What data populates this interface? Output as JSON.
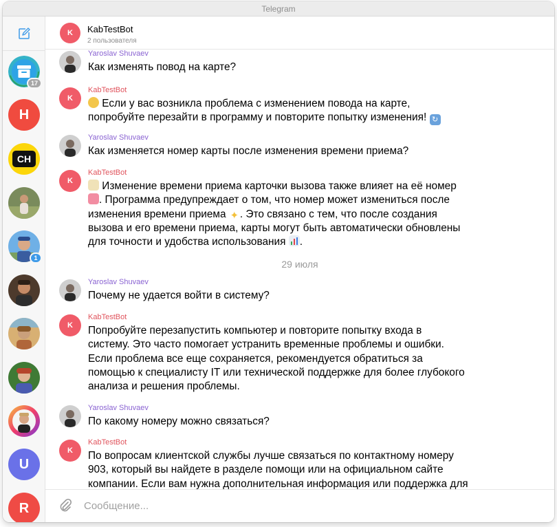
{
  "window": {
    "title": "Telegram"
  },
  "colors": {
    "bot_avatar": "#f05b68",
    "bot_name": "#e0535c",
    "user_name": "#8a63d2",
    "accent": "#3d9ae8"
  },
  "icons": {
    "compose": "compose-icon",
    "attach": "paperclip-icon"
  },
  "sidebar": {
    "chats": [
      {
        "type": "archive",
        "badge": "17"
      },
      {
        "type": "letter",
        "letter": "H",
        "color": "#f04b3f"
      },
      {
        "type": "logo",
        "letter": "CH"
      },
      {
        "type": "photo"
      },
      {
        "type": "photo",
        "badge": "1"
      },
      {
        "type": "photo"
      },
      {
        "type": "photo"
      },
      {
        "type": "photo"
      },
      {
        "type": "photo"
      },
      {
        "type": "letter",
        "letter": "U",
        "color": "#6a71e8"
      },
      {
        "type": "letter",
        "letter": "R",
        "color": "#ef4b45"
      }
    ]
  },
  "chat": {
    "title": "KabTestBot",
    "subtitle": "2 пользователя",
    "avatar_letter": "K"
  },
  "messages": [
    {
      "sender": "Yaroslav Shuvaev",
      "role": "user",
      "lines": [
        "Как изменять повод на карте?"
      ]
    },
    {
      "sender": "KabTestBot",
      "role": "bot",
      "lines": [
        "Если у вас возникла проблема с изменением повода на карте,",
        "попробуйте перезайти в программу и повторите попытку изменения!"
      ]
    },
    {
      "sender": "Yaroslav Shuvaev",
      "role": "user",
      "lines": [
        "Как изменяется номер карты после изменения времени приема?"
      ]
    },
    {
      "sender": "KabTestBot",
      "role": "bot",
      "lines": [
        "Изменение времени приема карточки вызова также влияет на её номер",
        ". Программа предупреждает о том, что номер может измениться после",
        "изменения времени приема",
        ". Это связано с тем, что после создания",
        "вызова и его времени приема, карты могут быть автоматически обновлены",
        "для точности и удобства использования",
        "."
      ]
    },
    {
      "sender": "Yaroslav Shuvaev",
      "role": "user",
      "lines": [
        "Почему не удается войти в систему?"
      ]
    },
    {
      "sender": "KabTestBot",
      "role": "bot",
      "lines": [
        "Попробуйте перезапустить компьютер и повторите попытку входа в",
        "систему. Это часто помогает устранить временные проблемы и ошибки.",
        "Если проблема все еще сохраняется, рекомендуется обратиться за",
        "помощью к специалисту IT или технической поддержке для более глубокого",
        "анализа и решения проблемы."
      ]
    },
    {
      "sender": "Yaroslav Shuvaev",
      "role": "user",
      "lines": [
        "По какому номеру можно связаться?"
      ]
    },
    {
      "sender": "KabTestBot",
      "role": "bot",
      "lines": [
        "По вопросам клиентской службы лучше связаться по контактному номеру",
        "903, который вы найдете в разделе помощи или на официальном сайте",
        "компании. Если вам нужна дополнительная информация или поддержка для"
      ]
    }
  ],
  "date_separator": "29 июля",
  "input": {
    "placeholder": "Сообщение..."
  }
}
